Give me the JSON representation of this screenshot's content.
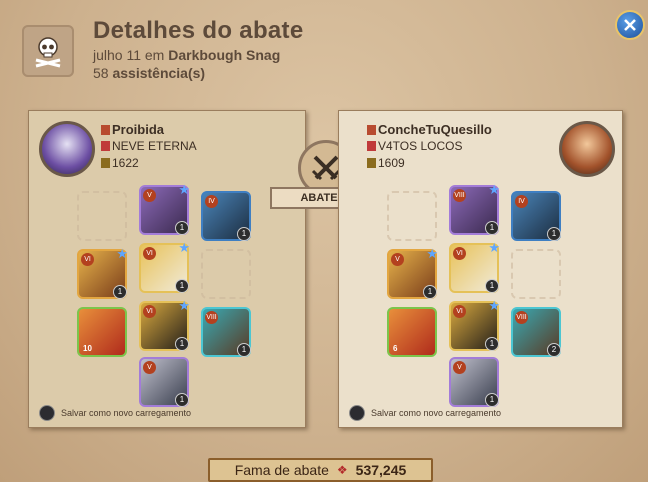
{
  "header": {
    "title": "Detalhes do abate",
    "date_prefix": "julho 11 em",
    "location": "Darkbough Snag",
    "assists_count": "58",
    "assists_label": "assistência(s)"
  },
  "killer": {
    "name": "Proibida",
    "guild": "NEVE ETERNA",
    "item_power": "1622",
    "slots": [
      {
        "id": "bag",
        "empty": true
      },
      {
        "id": "head",
        "tier": "V",
        "star": true,
        "badge": "1"
      },
      {
        "id": "cape",
        "tier": "IV",
        "badge": "1"
      },
      {
        "id": "mainhand",
        "tier": "VI",
        "star": true,
        "badge": "1"
      },
      {
        "id": "armor",
        "tier": "VI",
        "star": true,
        "badge": "1"
      },
      {
        "id": "offhand",
        "empty": true
      },
      {
        "id": "potion",
        "qty": "10"
      },
      {
        "id": "shoes",
        "tier": "VI",
        "star": true,
        "badge": "1"
      },
      {
        "id": "food",
        "tier": "VIII",
        "badge": "1"
      },
      {
        "id": "mount",
        "tier": "V",
        "badge": "1"
      }
    ],
    "save_loadout": "Salvar como novo carregamento"
  },
  "victim": {
    "name": "ConcheTuQuesillo",
    "guild": "V4TOS LOCOS",
    "item_power": "1609",
    "slots": [
      {
        "id": "bag",
        "empty": true
      },
      {
        "id": "head",
        "tier": "VIII",
        "star": true,
        "badge": "1"
      },
      {
        "id": "cape",
        "tier": "IV",
        "badge": "1"
      },
      {
        "id": "mainhand",
        "tier": "V",
        "star": true,
        "badge": "1"
      },
      {
        "id": "armor",
        "tier": "VI",
        "star": true,
        "badge": "1"
      },
      {
        "id": "offhand",
        "empty": true
      },
      {
        "id": "potion",
        "qty": "6"
      },
      {
        "id": "shoes",
        "tier": "VI",
        "star": true,
        "badge": "1"
      },
      {
        "id": "food",
        "tier": "VIII",
        "badge": "2"
      },
      {
        "id": "mount",
        "tier": "V",
        "badge": "1"
      }
    ],
    "save_loadout": "Salvar como novo carregamento"
  },
  "center": {
    "label": "ABATEU"
  },
  "fame": {
    "label": "Fama de abate",
    "value": "537,245"
  },
  "colors": {
    "gold_border": "#e9c467",
    "close_blue": "#1d4f9a",
    "fame_red": "#b32b2b"
  }
}
